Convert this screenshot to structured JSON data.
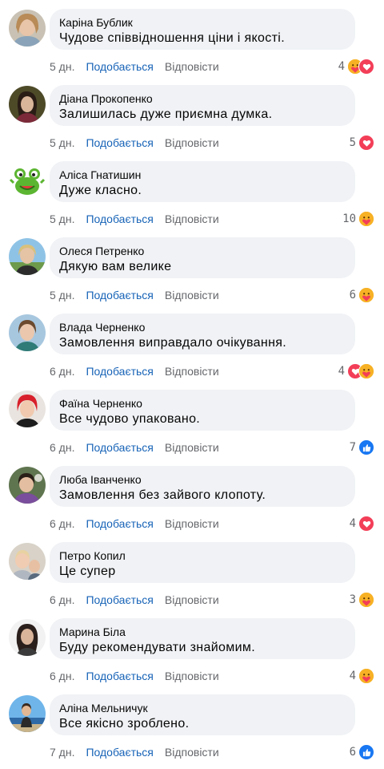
{
  "comments": [
    {
      "name": "Каріна Бублик",
      "text": "Чудове співвідношення ціни і якості.",
      "time": "5 дн.",
      "like_label": "Подобається",
      "reply_label": "Відповісти",
      "reaction_count": "4",
      "reactions": [
        "care-icon",
        "love-icon"
      ]
    },
    {
      "name": "Діана Прокопенко",
      "text": "Залишилась дуже приємна думка.",
      "time": "5 дн.",
      "like_label": "Подобається",
      "reply_label": "Відповісти",
      "reaction_count": "5",
      "reactions": [
        "love-icon"
      ]
    },
    {
      "name": "Аліса Гнатишин",
      "text": "Дуже класно.",
      "time": "5 дн.",
      "like_label": "Подобається",
      "reply_label": "Відповісти",
      "reaction_count": "10",
      "reactions": [
        "care-icon"
      ]
    },
    {
      "name": "Олеся Петренко",
      "text": "Дякую вам велике",
      "time": "5 дн.",
      "like_label": "Подобається",
      "reply_label": "Відповісти",
      "reaction_count": "6",
      "reactions": [
        "care-icon"
      ]
    },
    {
      "name": "Влада Черненко",
      "text": "Замовлення виправдало очікування.",
      "time": "6 дн.",
      "like_label": "Подобається",
      "reply_label": "Відповісти",
      "reaction_count": "4",
      "reactions": [
        "love-icon",
        "care-icon"
      ]
    },
    {
      "name": "Фаїна Черненко",
      "text": "Все чудово упаковано.",
      "time": "6 дн.",
      "like_label": "Подобається",
      "reply_label": "Відповісти",
      "reaction_count": "7",
      "reactions": [
        "like-icon"
      ]
    },
    {
      "name": "Люба Іванченко",
      "text": "Замовлення без зайвого клопоту.",
      "time": "6 дн.",
      "like_label": "Подобається",
      "reply_label": "Відповісти",
      "reaction_count": "4",
      "reactions": [
        "love-icon"
      ]
    },
    {
      "name": "Петро Копил",
      "text": "Це супер",
      "time": "6 дн.",
      "like_label": "Подобається",
      "reply_label": "Відповісти",
      "reaction_count": "3",
      "reactions": [
        "care-icon"
      ]
    },
    {
      "name": "Марина Біла",
      "text": "Буду рекомендувати знайомим.",
      "time": "6 дн.",
      "like_label": "Подобається",
      "reply_label": "Відповісти",
      "reaction_count": "4",
      "reactions": [
        "care-icon"
      ]
    },
    {
      "name": "Аліна Мельничук",
      "text": "Все якісно зроблено.",
      "time": "7 дн.",
      "like_label": "Подобається",
      "reply_label": "Відповісти",
      "reaction_count": "6",
      "reactions": [
        "like-icon"
      ]
    }
  ],
  "colors": {
    "bubble": "#f0f2f5",
    "link": "#1763b7",
    "muted": "#65676b",
    "like": "#1877f2",
    "love": "#f33e58",
    "care": "#f7b125"
  }
}
